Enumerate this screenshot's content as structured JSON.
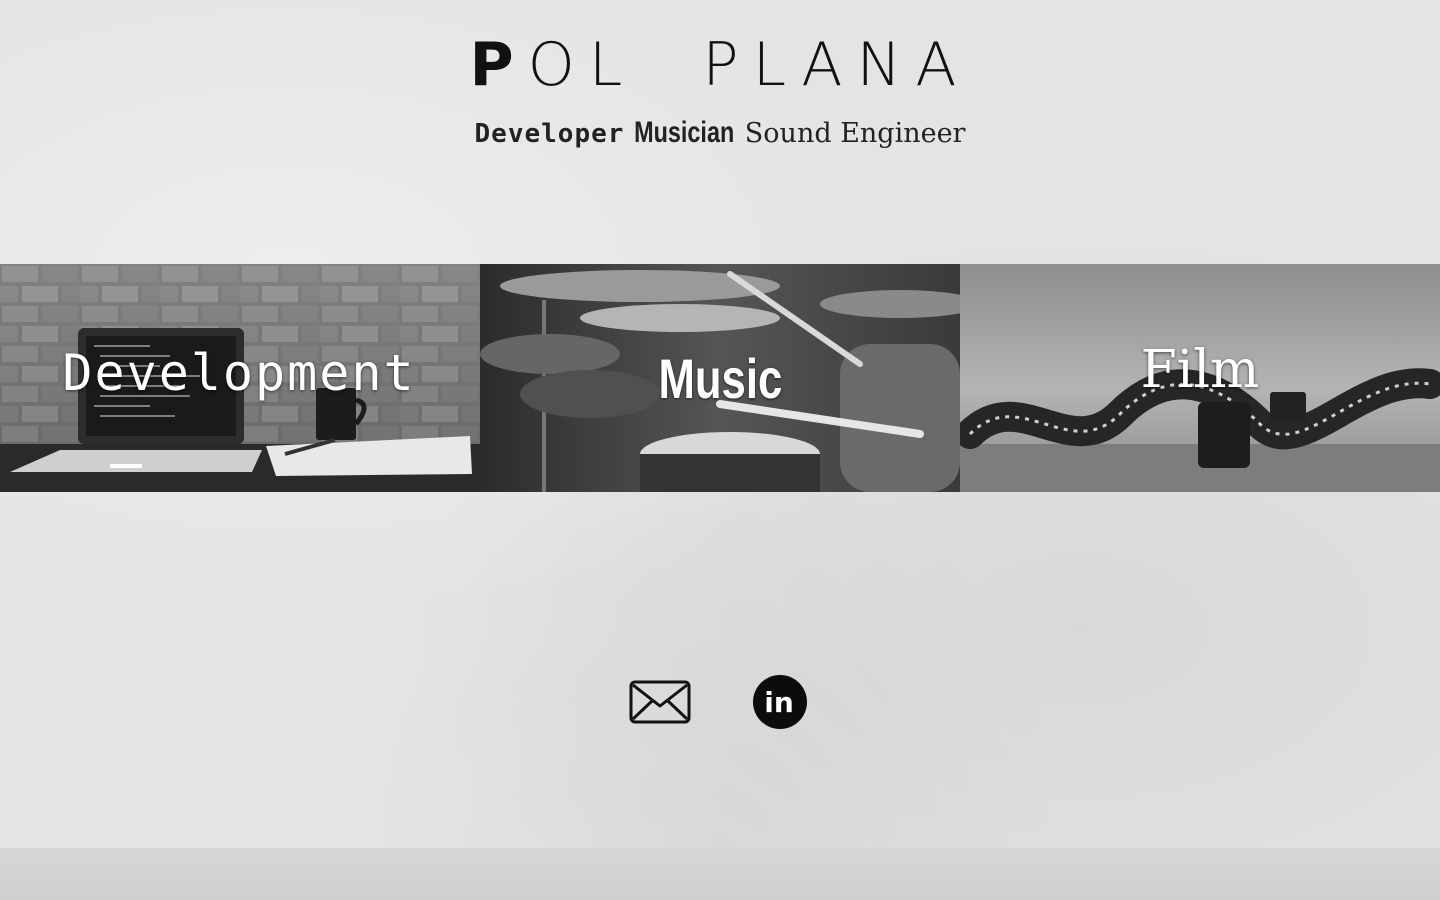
{
  "header": {
    "title_first": "P",
    "title_rest": "OL  PLANA",
    "tagline": {
      "developer": "Developer",
      "musician": "Musician",
      "sound_engineer": "Sound Engineer"
    }
  },
  "panels": [
    {
      "label": "Development"
    },
    {
      "label": "Music"
    },
    {
      "label": "Film"
    }
  ],
  "social": {
    "mail_icon": "envelope-icon",
    "linkedin_icon": "linkedin-icon",
    "linkedin_text": "in"
  }
}
